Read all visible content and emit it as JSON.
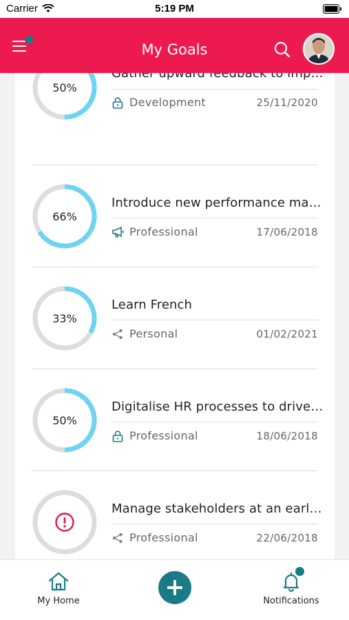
{
  "status_bar": {
    "carrier": "Carrier",
    "time": "5:19 PM"
  },
  "header": {
    "title": "My Goals"
  },
  "colors": {
    "brand": "#ec1a4f",
    "accent": "#1a7a85",
    "progress": "#6fd4f2",
    "track": "#dddddd"
  },
  "goals": [
    {
      "progress_label": "50%",
      "progress": 0.5,
      "title": "Gather upward feedback to imp…",
      "type": "Development",
      "type_icon": "lock-icon",
      "date": "25/11/2020"
    },
    {
      "progress_label": "66%",
      "progress": 0.66,
      "title": "Introduce new performance ma…",
      "type": "Professional",
      "type_icon": "megaphone-icon",
      "date": "17/06/2018"
    },
    {
      "progress_label": "33%",
      "progress": 0.33,
      "title": "Learn French",
      "type": "Personal",
      "type_icon": "share-icon",
      "date": "01/02/2021"
    },
    {
      "progress_label": "50%",
      "progress": 0.5,
      "title": "Digitalise HR processes to drive…",
      "type": "Professional",
      "type_icon": "lock-icon",
      "date": "18/06/2018"
    },
    {
      "progress_label": "",
      "progress": 0,
      "status_icon": "alert-icon",
      "title": "Manage stakeholders at an earl…",
      "type": "Professional",
      "type_icon": "share-icon",
      "date": "22/06/2018"
    }
  ],
  "bottom_nav": {
    "home_label": "My Home",
    "notifications_label": "Notifications"
  }
}
